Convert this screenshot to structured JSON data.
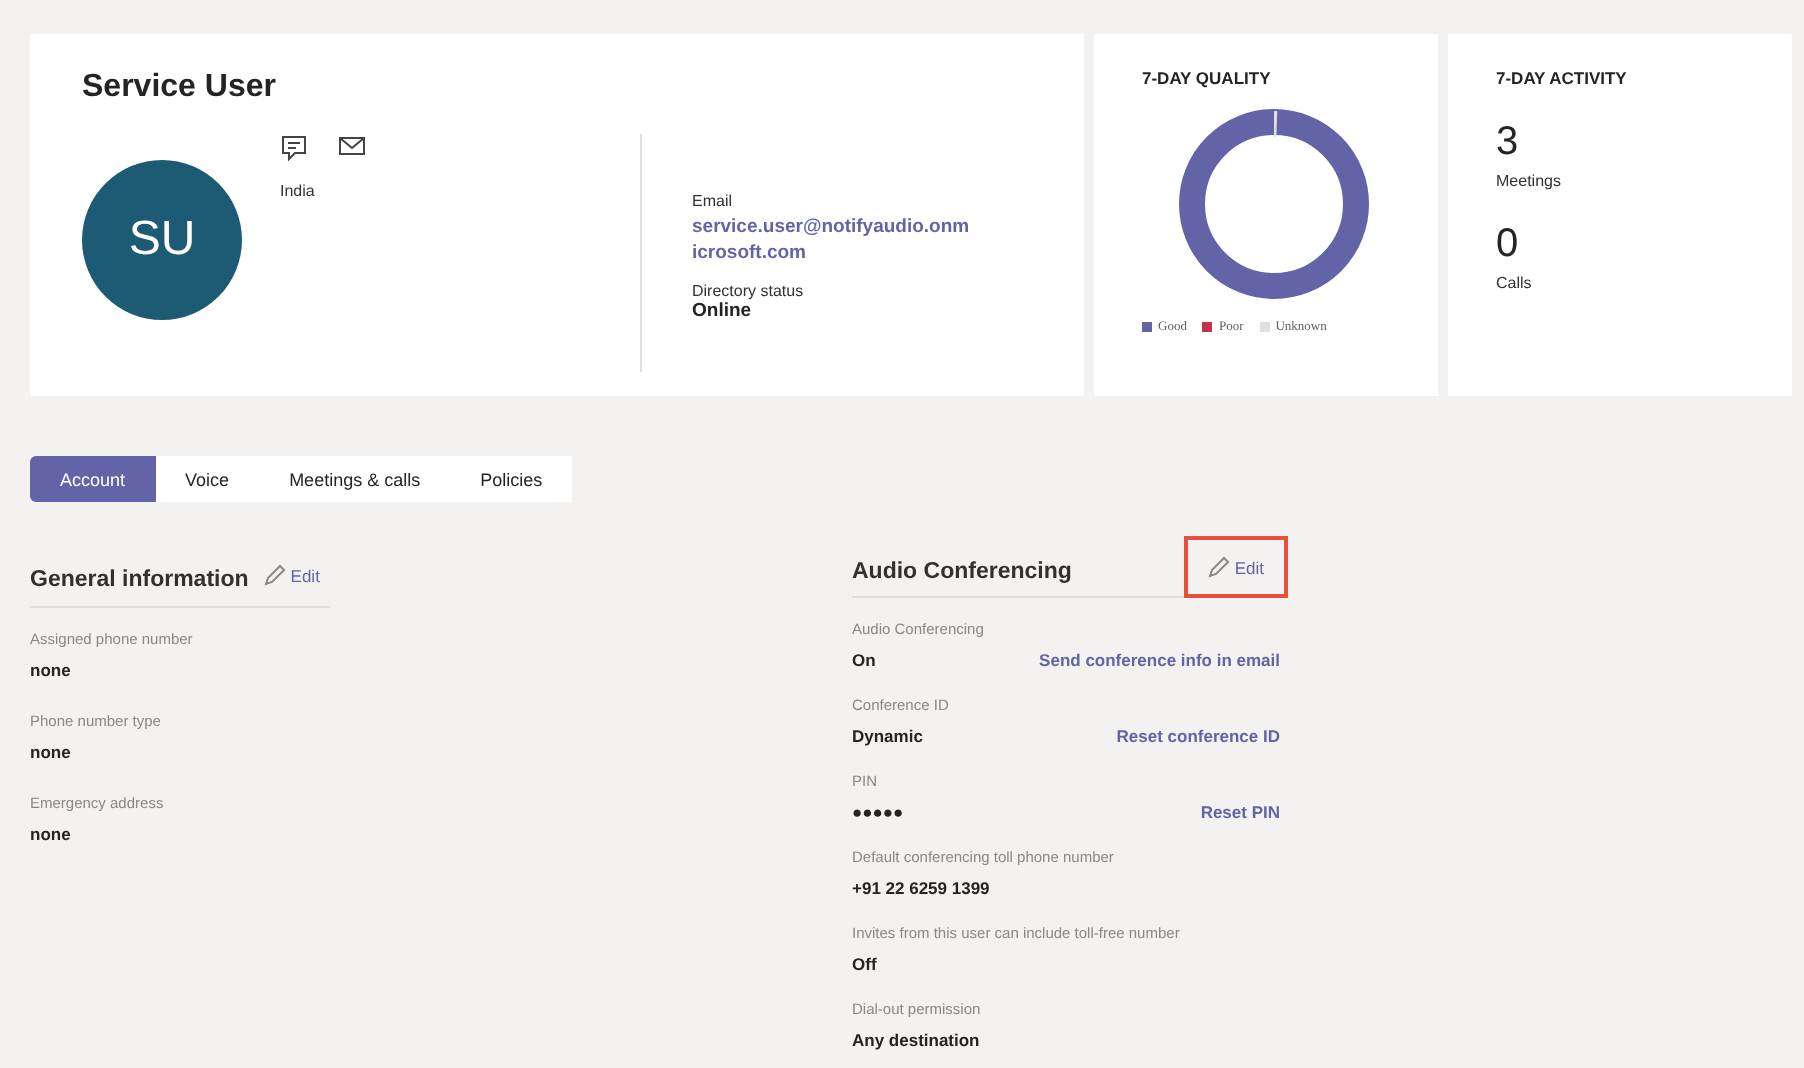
{
  "profile": {
    "name": "Service User",
    "initials": "SU",
    "location": "India",
    "email_label": "Email",
    "email": "service.user@notifyaudio.onm icrosoft.com",
    "status_label": "Directory status",
    "status": "Online"
  },
  "quality": {
    "title": "7-DAY QUALITY",
    "legend": [
      {
        "label": "Good",
        "color": "#6264a7"
      },
      {
        "label": "Poor",
        "color": "#c4314b"
      },
      {
        "label": "Unknown",
        "color": "#e1dfdd"
      }
    ]
  },
  "activity": {
    "title": "7-DAY ACTIVITY",
    "stats": [
      {
        "value": "3",
        "label": "Meetings"
      },
      {
        "value": "0",
        "label": "Calls"
      }
    ]
  },
  "tabs": [
    {
      "label": "Account",
      "selected": true
    },
    {
      "label": "Voice",
      "selected": false
    },
    {
      "label": "Meetings & calls",
      "selected": false
    },
    {
      "label": "Policies",
      "selected": false
    }
  ],
  "general": {
    "title": "General information",
    "edit": "Edit",
    "fields": [
      {
        "label": "Assigned phone number",
        "value": "none"
      },
      {
        "label": "Phone number type",
        "value": "none"
      },
      {
        "label": "Emergency address",
        "value": "none"
      }
    ]
  },
  "audio": {
    "title": "Audio Conferencing",
    "edit": "Edit",
    "edit_highlighted": true,
    "fields": [
      {
        "label": "Audio Conferencing",
        "value": "On",
        "action": "Send conference info in email"
      },
      {
        "label": "Conference ID",
        "value": "Dynamic",
        "action": "Reset conference ID"
      },
      {
        "label": "PIN",
        "value": "●●●●●",
        "action": "Reset PIN"
      },
      {
        "label": "Default conferencing toll phone number",
        "value": "+91 22 6259 1399"
      },
      {
        "label": "Invites from this user can include toll-free number",
        "value": "Off"
      },
      {
        "label": "Dial-out permission",
        "value": "Any destination"
      }
    ]
  }
}
